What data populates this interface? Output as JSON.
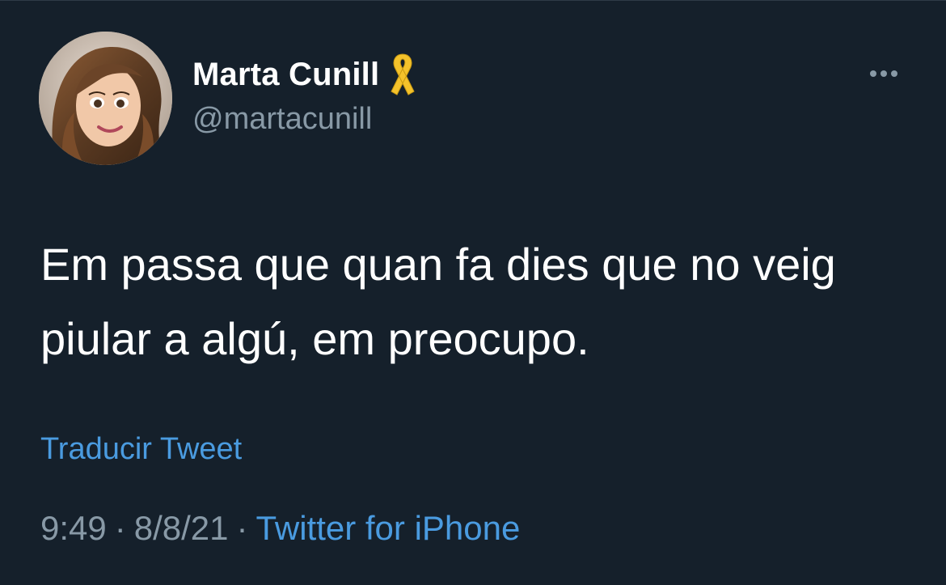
{
  "tweet": {
    "display_name": "Marta Cunill",
    "handle": "@martacunill",
    "text": "Em passa que quan fa dies que no veig piular a algú, em preocupo.",
    "translate_label": "Traducir Tweet",
    "time": "9:49",
    "date": "8/8/21",
    "separator": "·",
    "source": "Twitter for iPhone"
  },
  "icons": {
    "badge": "yellow-ribbon-icon",
    "menu": "more-options-icon",
    "avatar": "profile-avatar"
  },
  "colors": {
    "background": "#15202b",
    "primary_text": "#ffffff",
    "secondary_text": "#8899a6",
    "link": "#4a9be0",
    "ribbon": "#f4c22b"
  }
}
